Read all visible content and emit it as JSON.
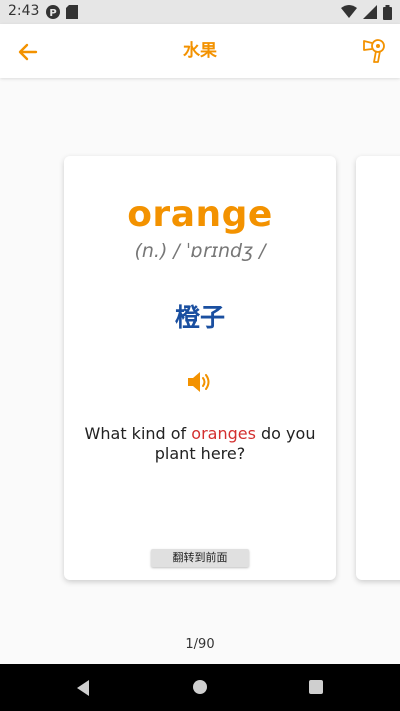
{
  "status_bar": {
    "time": "2:43",
    "icons": [
      "p-badge-icon",
      "sd-card-icon",
      "wifi-icon",
      "signal-icon",
      "battery-icon"
    ]
  },
  "app_bar": {
    "title": "水果",
    "back_icon": "arrow-left-icon",
    "settings_icon": "hair-dryer-icon"
  },
  "card": {
    "word": "orange",
    "phonetic": "(n.) / ˈɒrɪndʒ /",
    "translation": "橙子",
    "audio_icon": "speaker-icon",
    "example_before": "What kind of ",
    "example_highlight": "oranges",
    "example_after": " do you plant here?",
    "flip_button_label": "翻转到前面"
  },
  "pagination": {
    "label": "1/90"
  },
  "colors": {
    "accent": "#f39200",
    "translation": "#1a4fa0",
    "highlight": "#d32f2f"
  }
}
